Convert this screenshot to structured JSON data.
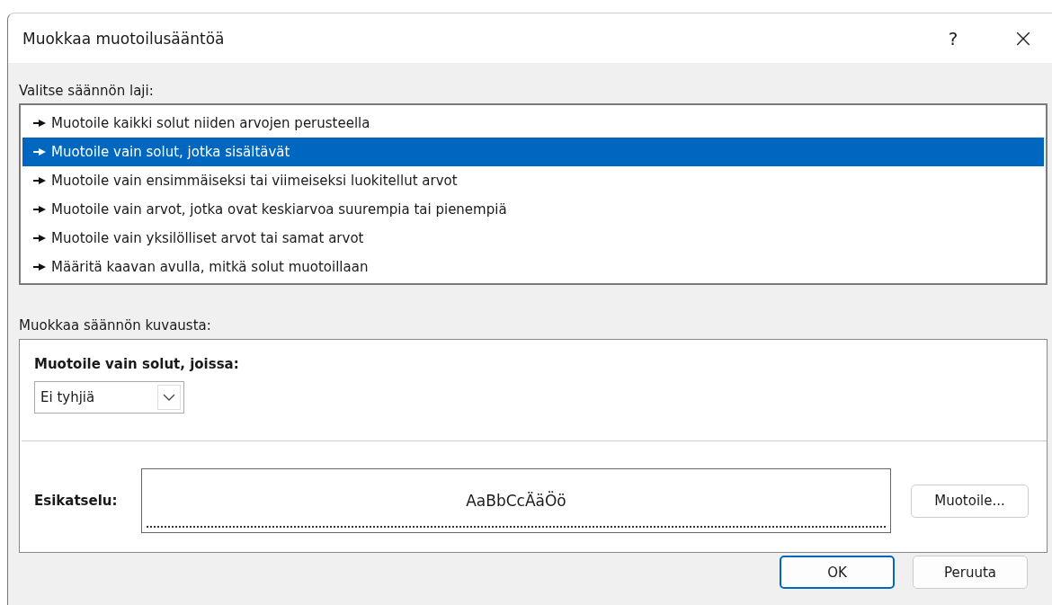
{
  "window": {
    "title": "Muokkaa muotoilusääntöä",
    "help": "?",
    "close": "×"
  },
  "rule_type": {
    "label": "Valitse säännön laji:",
    "items": [
      {
        "label": "Muotoile kaikki solut niiden arvojen perusteella",
        "selected": false
      },
      {
        "label": "Muotoile vain solut, jotka sisältävät",
        "selected": true
      },
      {
        "label": "Muotoile vain ensimmäiseksi tai viimeiseksi luokitellut arvot",
        "selected": false
      },
      {
        "label": "Muotoile vain arvot, jotka ovat keskiarvoa suurempia tai pienempiä",
        "selected": false
      },
      {
        "label": "Muotoile vain yksilölliset arvot tai samat arvot",
        "selected": false
      },
      {
        "label": "Määritä kaavan avulla, mitkä solut muotoillaan",
        "selected": false
      }
    ]
  },
  "description": {
    "label": "Muokkaa säännön kuvausta:",
    "heading": "Muotoile vain solut, joissa:",
    "condition": "Ei tyhjiä",
    "preview_label": "Esikatselu:",
    "preview_text": "AaBbCcÄäÖö",
    "format_button": "Muotoile..."
  },
  "buttons": [
    "OK",
    "Peruuta"
  ]
}
